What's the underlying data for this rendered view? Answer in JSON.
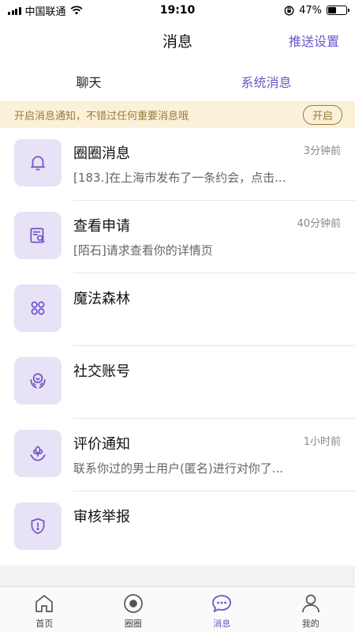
{
  "status_bar": {
    "carrier": "中国联通",
    "time": "19:10",
    "battery_text": "47%",
    "battery_level": 0.47
  },
  "header": {
    "title": "消息",
    "push_settings": "推送设置"
  },
  "tabs": [
    {
      "label": "聊天",
      "active": false
    },
    {
      "label": "系统消息",
      "active": true
    }
  ],
  "notice": {
    "text": "开启消息通知，不错过任何重要消息哦",
    "button": "开启"
  },
  "items": [
    {
      "title": "圈圈消息",
      "time": "3分钟前",
      "subtitle": "[183.]在上海市发布了一条约会，点击...",
      "icon": "bell-icon"
    },
    {
      "title": "查看申请",
      "time": "40分钟前",
      "subtitle": "[陌石]请求查看你的详情页",
      "icon": "document-search-icon"
    },
    {
      "title": "魔法森林",
      "time": "",
      "subtitle": "",
      "icon": "clover-icon"
    },
    {
      "title": "社交账号",
      "time": "",
      "subtitle": "",
      "icon": "hands-heart-icon"
    },
    {
      "title": "评价通知",
      "time": "1小时前",
      "subtitle": "联系你过的男士用户(匿名)进行对你了...",
      "icon": "flower-hands-icon"
    },
    {
      "title": "审核举报",
      "time": "",
      "subtitle": "",
      "icon": "shield-alert-icon"
    }
  ],
  "bottom_nav": [
    {
      "label": "首页",
      "icon": "home-icon",
      "active": false
    },
    {
      "label": "圈圈",
      "icon": "circle-dot-icon",
      "active": false
    },
    {
      "label": "消息",
      "icon": "chat-bubble-icon",
      "active": true
    },
    {
      "label": "我的",
      "icon": "person-icon",
      "active": false
    }
  ],
  "colors": {
    "accent": "#6e55c9",
    "icon_bg": "#e8e2f7",
    "notice_bg": "#fbf0d8",
    "notice_text": "#9a7a3f"
  }
}
